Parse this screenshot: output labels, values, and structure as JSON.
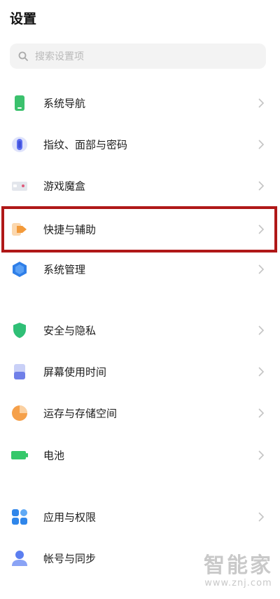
{
  "header": {
    "title": "设置"
  },
  "search": {
    "placeholder": "搜索设置项"
  },
  "settings_items": [
    {
      "label": "系统导航",
      "icon": "phone-icon",
      "color": "#3bc16d"
    },
    {
      "label": "指纹、面部与密码",
      "icon": "fingerprint-icon",
      "color": "#5b6cf0"
    },
    {
      "label": "游戏魔盒",
      "icon": "game-box-icon",
      "color": "#d9dde6"
    },
    {
      "label": "快捷与辅助",
      "icon": "shortcut-arrow-icon",
      "color": "#f39a3a"
    },
    {
      "label": "系统管理",
      "icon": "hexagon-icon",
      "color": "#2f7fe8"
    },
    {
      "label": "安全与隐私",
      "icon": "shield-icon",
      "color": "#2fbf76"
    },
    {
      "label": "屏幕使用时间",
      "icon": "hourglass-icon",
      "color": "#6f7fe8"
    },
    {
      "label": "运存与存储空间",
      "icon": "pie-chart-icon",
      "color": "#f5a04a"
    },
    {
      "label": "电池",
      "icon": "battery-icon",
      "color": "#35c86a"
    },
    {
      "label": "应用与权限",
      "icon": "apps-grid-icon",
      "color": "#2f86ea"
    },
    {
      "label": "帐号与同步",
      "icon": "user-icon",
      "color": "#5b7ef0"
    }
  ],
  "highlighted_item": "快捷与辅助",
  "highlight_color": "#b01818",
  "watermark": {
    "text": "智能家",
    "url": "www.znj.com"
  }
}
